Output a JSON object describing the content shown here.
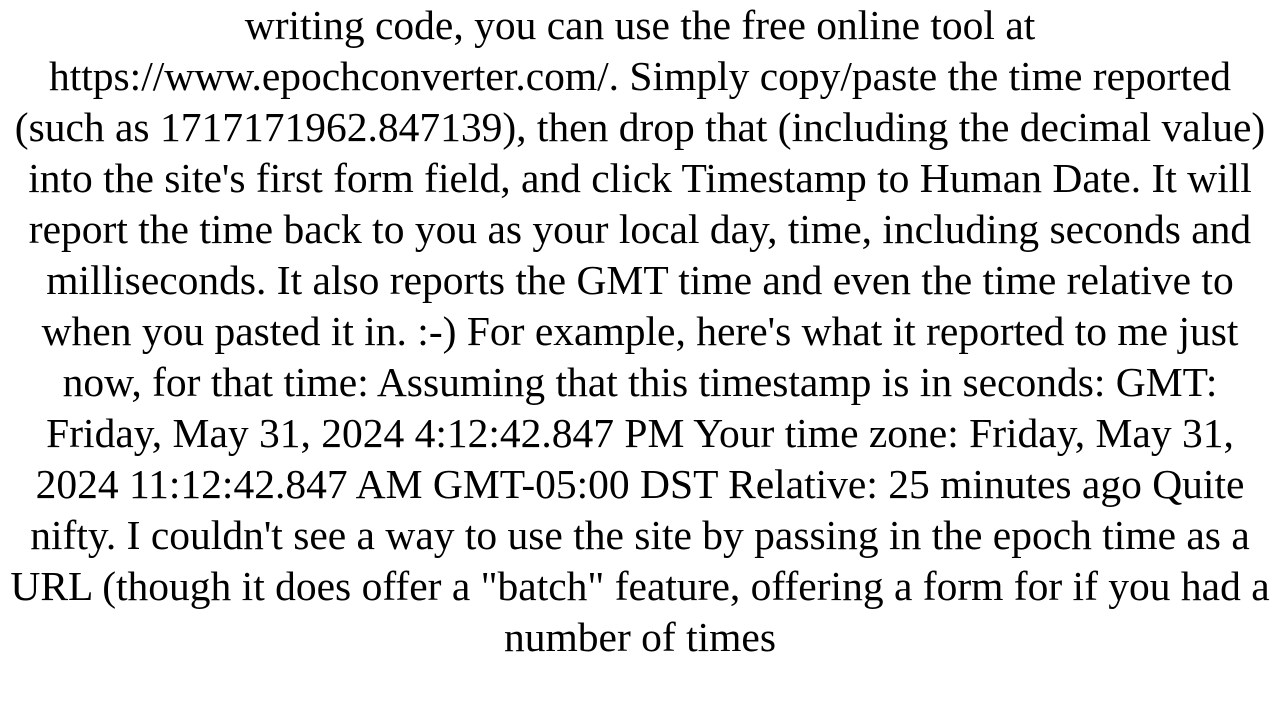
{
  "document": {
    "body_text": "writing code, you can use the free online tool at https://www.epochconverter.com/. Simply copy/paste the time reported (such as 1717171962.847139), then drop that (including the decimal value) into the site's first form field, and click Timestamp to Human Date. It will report the time back to you as your local day, time, including seconds and milliseconds. It also reports the GMT time and even the time relative to when you pasted it in. :-) For example, here's what it reported to me just now, for that time: Assuming that this timestamp is in seconds: GMT: Friday, May 31, 2024 4:12:42.847 PM Your time zone: Friday, May 31, 2024 11:12:42.847 AM GMT-05:00 DST Relative: 25 minutes ago Quite nifty. I couldn't see a way to use the site by passing in the epoch time as a URL (though it does offer a \"batch\" feature, offering a form for if you had a number of times"
  }
}
